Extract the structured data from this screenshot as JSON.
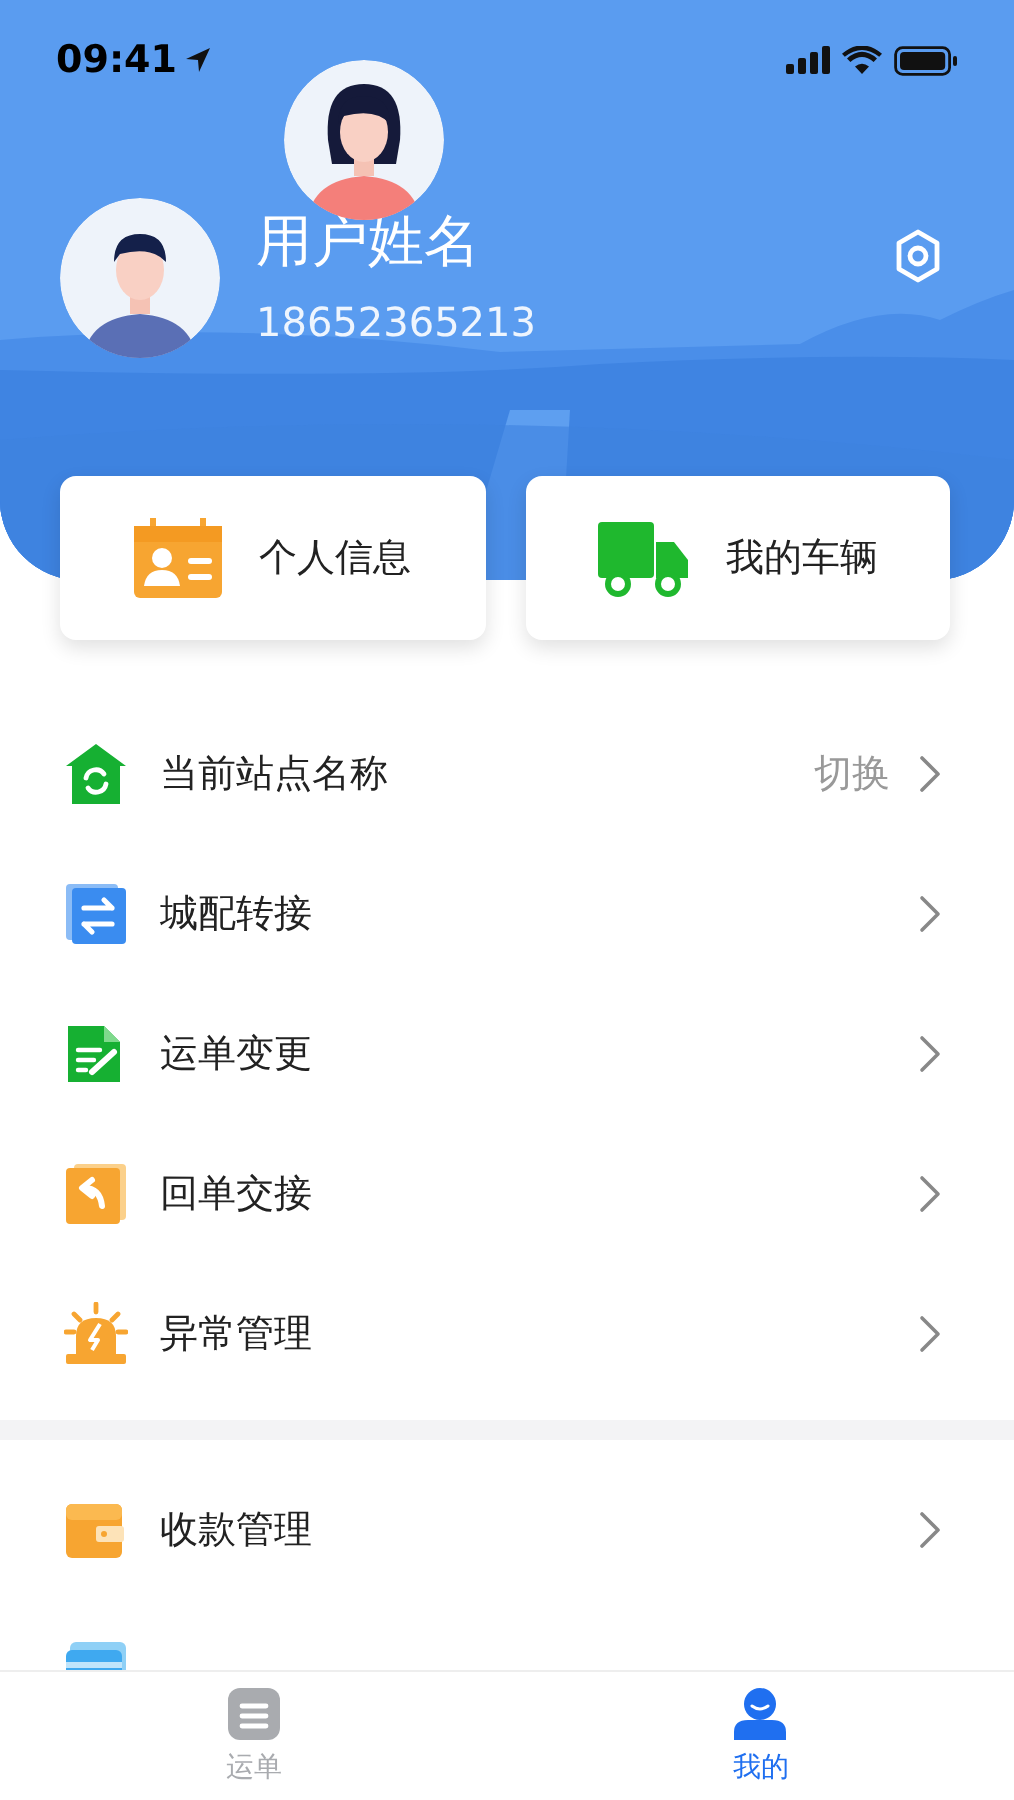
{
  "status_bar": {
    "time": "09:41"
  },
  "profile": {
    "name": "用户姓名",
    "phone": "18652365213"
  },
  "shortcuts": [
    {
      "label": "个人信息",
      "kind": "id-card"
    },
    {
      "label": "我的车辆",
      "kind": "truck"
    }
  ],
  "menu_sections": [
    {
      "items": [
        {
          "label": "当前站点名称",
          "kind": "station",
          "action": "切换"
        },
        {
          "label": "城配转接",
          "kind": "transfer"
        },
        {
          "label": "运单变更",
          "kind": "edit"
        },
        {
          "label": "回单交接",
          "kind": "return"
        },
        {
          "label": "异常管理",
          "kind": "alarm"
        }
      ]
    },
    {
      "items": [
        {
          "label": "收款管理",
          "kind": "wallet"
        },
        {
          "kind": "card"
        }
      ]
    }
  ],
  "tab_bar": [
    {
      "label": "运单",
      "kind": "list",
      "selected": false
    },
    {
      "label": "我的",
      "kind": "person",
      "selected": true
    }
  ]
}
